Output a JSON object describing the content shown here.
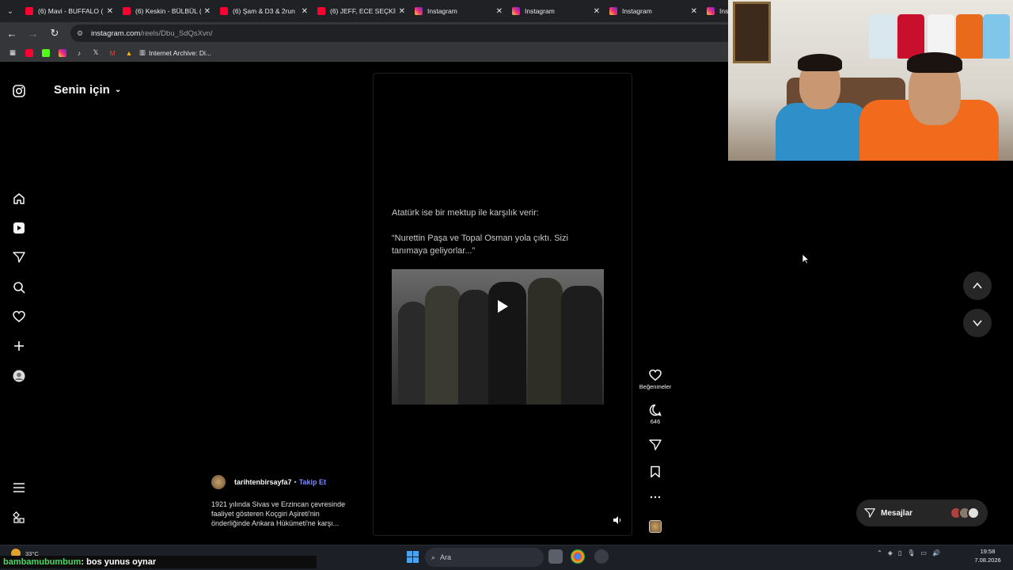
{
  "browser": {
    "tabs": [
      {
        "title": "(6) Mavi - BUFFALO (",
        "favicon": "youtube-icon"
      },
      {
        "title": "(6) Keskin - BÜLBÜL (",
        "favicon": "youtube-icon"
      },
      {
        "title": "(6) Şam & D3 & 2run",
        "favicon": "youtube-icon"
      },
      {
        "title": "(6) JEFF, ECE SEÇKİN",
        "favicon": "youtube-icon"
      },
      {
        "title": "Instagram",
        "favicon": "instagram-icon"
      },
      {
        "title": "Instagram",
        "favicon": "instagram-icon"
      },
      {
        "title": "Instagram",
        "favicon": "instagram-icon"
      },
      {
        "title": "Ins",
        "favicon": "instagram-icon"
      }
    ],
    "address": {
      "host": "instagram.com",
      "path": "/reels/Dbu_SdQsXvn/"
    },
    "bookmark_label": "Internet Archive: Di..."
  },
  "instagram": {
    "feed_title": "Senin için",
    "reel": {
      "text_line1": "Atatürk ise bir mektup ile karşılık verir:",
      "text_quote": "“Nurettin Paşa ve Topal Osman yola çıktı. Sizi tanımaya geliyorlar...”",
      "like_label": "Beğenmeler",
      "comment_count": "646"
    },
    "author": {
      "username": "tarihtenbirsayfa7",
      "separator": "•",
      "follow_label": "Takip Et",
      "caption": "1921 yılında Sivas ve Erzincan çevresinde faaliyet gösteren Koçgiri Aşireti'nin önderliğinde Ankara Hükümeti'ne karşı..."
    },
    "messages_label": "Mesajlar"
  },
  "taskbar": {
    "temperature": "33°C",
    "search_placeholder": "Ara",
    "time": "19:58",
    "date": "7.08.2026"
  },
  "stream_overlay": {
    "username": "bambamubumbum",
    "message": ": bos yunus oynar"
  },
  "colors": {
    "background": "#000000",
    "accent_link": "#7c8bff",
    "chat_username": "#4cd964"
  }
}
